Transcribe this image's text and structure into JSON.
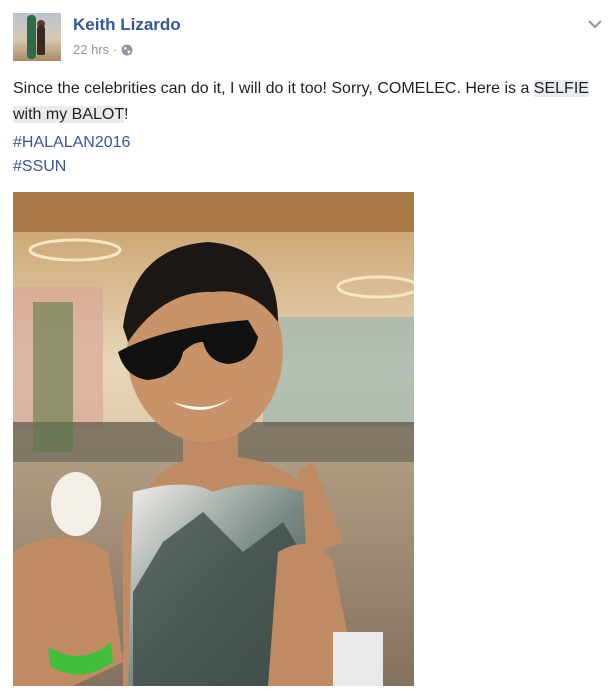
{
  "post": {
    "author": "Keith Lizardo",
    "time": "22 hrs",
    "separator": "·",
    "privacy_icon": "globe-icon",
    "options_icon": "chevron-down-icon",
    "text_before": "Since the celebrities can do it, I will do it too! Sorry, COMELEC. Here is a ",
    "text_highlight": "SELFIE with my BALOT",
    "text_after": "!",
    "hashtags": [
      "#HALALAN2016",
      "#SSUN"
    ]
  },
  "colors": {
    "link": "#365899",
    "meta": "#90949c",
    "text": "#1d2129"
  }
}
